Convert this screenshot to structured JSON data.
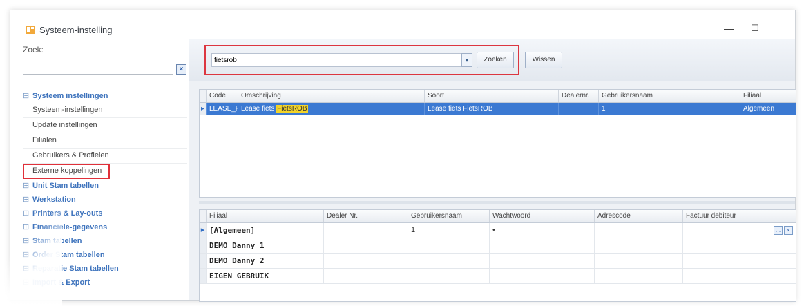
{
  "window": {
    "title": "Systeem-instelling",
    "minimize": "—",
    "maximize": "☐"
  },
  "left": {
    "search_label": "Zoek:",
    "search_value": "",
    "clear_label": "×",
    "tree": [
      {
        "label": "Systeem instellingen",
        "expanded": true,
        "children": [
          "Systeem-instellingen",
          "Update instellingen",
          "Filialen",
          "Gebruikers & Profielen",
          "Externe koppelingen"
        ]
      },
      {
        "label": "Unit Stam tabellen"
      },
      {
        "label": "Werkstation"
      },
      {
        "label": "Printers & Lay-outs"
      },
      {
        "label": "Financiele-gegevens"
      },
      {
        "label": "Stam tabellen"
      },
      {
        "label": "Order Stam tabellen"
      },
      {
        "label": "Reparatie Stam tabellen"
      },
      {
        "label": "Import & Export"
      }
    ],
    "selected_item": "Externe koppelingen"
  },
  "toolbar": {
    "filter_value": "fietsrob",
    "search_button": "Zoeken",
    "clear_button": "Wissen"
  },
  "grid1": {
    "columns": [
      "Code",
      "Omschrijving",
      "Soort",
      "Dealernr.",
      "Gebruikersnaam",
      "Filiaal"
    ],
    "rows": [
      {
        "code": "LEASE_FIE...",
        "omschrijving_prefix": "Lease fiets ",
        "omschrijving_match": "FietsROB",
        "soort": "Lease fiets FietsROB",
        "dealernr": "",
        "gebruikersnaam": "1",
        "filiaal": "Algemeen"
      }
    ]
  },
  "grid2": {
    "columns": [
      "Filiaal",
      "Dealer Nr.",
      "Gebruikersnaam",
      "Wachtwoord",
      "Adrescode",
      "Factuur debiteur"
    ],
    "rows": [
      {
        "filiaal": "[Algemeen]",
        "dealer": "",
        "gebruikersnaam": "1",
        "wachtwoord": "•",
        "adrescode": "",
        "factuur": ""
      },
      {
        "filiaal": "DEMO Danny 1",
        "dealer": "",
        "gebruikersnaam": "",
        "wachtwoord": "",
        "adrescode": "",
        "factuur": ""
      },
      {
        "filiaal": "DEMO Danny 2",
        "dealer": "",
        "gebruikersnaam": "",
        "wachtwoord": "",
        "adrescode": "",
        "factuur": ""
      },
      {
        "filiaal": "EIGEN GEBRUIK",
        "dealer": "",
        "gebruikersnaam": "",
        "wachtwoord": "",
        "adrescode": "",
        "factuur": ""
      }
    ],
    "row_buttons": [
      "…",
      "×"
    ]
  },
  "colors": {
    "accent": "#3b79d2",
    "highlight": "#f3d429",
    "callout": "#dc3640",
    "tree_group": "#3f74bd"
  }
}
